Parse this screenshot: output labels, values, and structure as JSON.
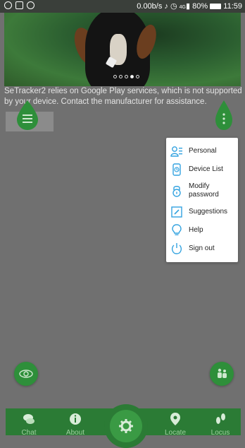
{
  "status_bar": {
    "speed": "0.00b/s",
    "network": "4G",
    "battery": "80%",
    "time": "11:59"
  },
  "banner": {
    "active_dot_index": 3,
    "dot_count": 5
  },
  "message": "SeTracker2 relies on Google Play services, which is not supported by your device. Contact the manufacturer for assistance.",
  "popup_menu": {
    "items": [
      {
        "label": "Personal",
        "icon": "person-card-icon"
      },
      {
        "label": "Device List",
        "icon": "watch-icon"
      },
      {
        "label": "Modify password",
        "icon": "lock-icon"
      },
      {
        "label": "Suggestions",
        "icon": "edit-icon"
      },
      {
        "label": "Help",
        "icon": "lightbulb-icon"
      },
      {
        "label": "Sign out",
        "icon": "power-icon"
      }
    ]
  },
  "tabs": [
    {
      "label": "Chat",
      "icon": "chat-icon"
    },
    {
      "label": "About",
      "icon": "info-icon"
    },
    {
      "label": "",
      "icon": "gear-icon"
    },
    {
      "label": "Locate",
      "icon": "location-pin-icon"
    },
    {
      "label": "Locus",
      "icon": "footprints-icon"
    }
  ],
  "colors": {
    "accent": "#2e8f3a",
    "tabbar": "#2b7b35",
    "overlay": "#707070"
  }
}
